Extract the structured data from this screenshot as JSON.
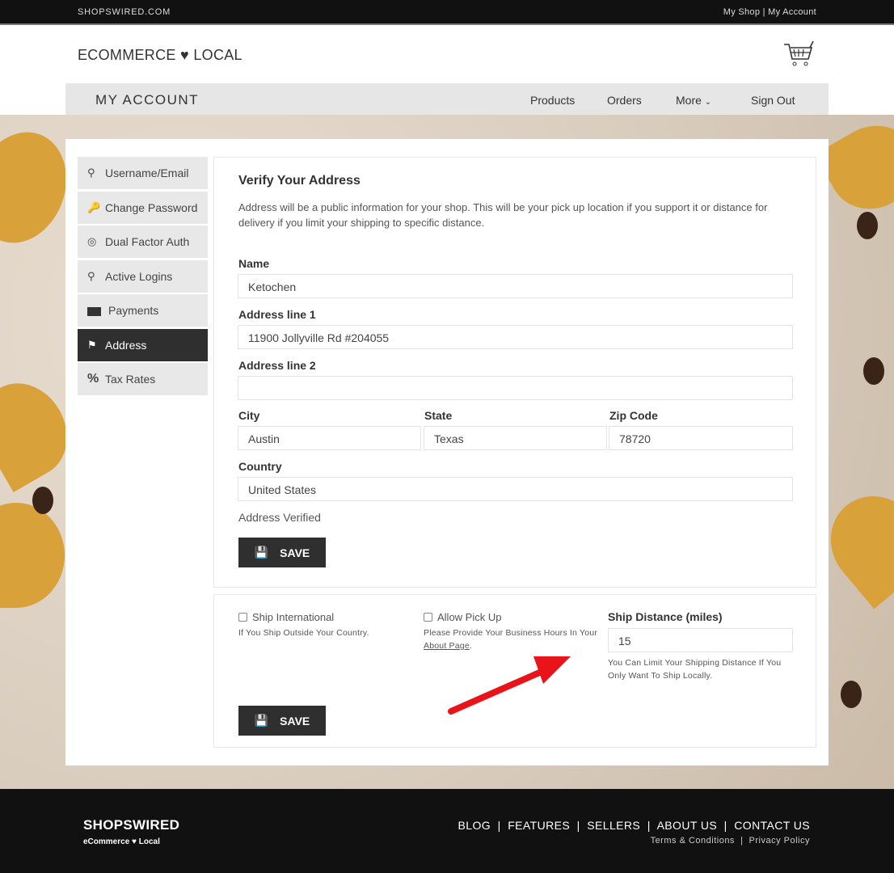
{
  "topbar": {
    "site": "SHOPSWIRED.COM",
    "my_shop": "My Shop",
    "sep": "|",
    "my_account": "My Account"
  },
  "header": {
    "logo_left": "ECOMMERCE",
    "logo_right": "LOCAL"
  },
  "nav": {
    "title": "MY ACCOUNT",
    "items": [
      "Products",
      "Orders",
      "More",
      "Sign Out"
    ]
  },
  "sidebar": {
    "items": [
      {
        "label": "Username/Email",
        "icon": "user-icon",
        "active": false
      },
      {
        "label": "Change Password",
        "icon": "key-icon",
        "active": false
      },
      {
        "label": "Dual Factor Auth",
        "icon": "fingerprint-icon",
        "active": false
      },
      {
        "label": "Active Logins",
        "icon": "user-icon",
        "active": false
      },
      {
        "label": "Payments",
        "icon": "money-bill-icon",
        "active": false
      },
      {
        "label": "Address",
        "icon": "map-marked-icon",
        "active": true
      },
      {
        "label": "Tax Rates",
        "icon": "percent-icon",
        "active": false
      }
    ]
  },
  "address": {
    "title": "Verify Your Address",
    "description": "Address will be a public information for your shop. This will be your pick up location if you support it or distance for delivery if you limit your shipping to specific distance.",
    "name_label": "Name",
    "name": "Ketochen",
    "line1_label": "Address line 1",
    "line1": "11900 Jollyville Rd #204055",
    "line2_label": "Address line 2",
    "line2": "",
    "city_label": "City",
    "city": "Austin",
    "state_label": "State",
    "state": "Texas",
    "zip_label": "Zip Code",
    "zip": "78720",
    "country_label": "Country",
    "country": "United States",
    "status": "Address Verified",
    "save": "SAVE"
  },
  "shipping": {
    "intl_label": "Ship International",
    "intl_checked": false,
    "intl_hint": "If You Ship Outside Your Country.",
    "pickup_label": "Allow Pick Up",
    "pickup_checked": false,
    "pickup_hint": "Please Provide Your Business Hours In Your",
    "pickup_link": "About Page",
    "distance_label": "Ship Distance (miles)",
    "distance": "15",
    "distance_hint": "You Can Limit Your Shipping Distance If You Only Want To Ship Locally.",
    "save": "SAVE"
  },
  "annotation_color": "#e8141a",
  "footer": {
    "brand": "SHOPSWIRED",
    "tagline_left": "eCommerce",
    "tagline_right": "Local",
    "links": [
      "BLOG",
      "FEATURES",
      "SELLERS",
      "ABOUT US",
      "CONTACT US"
    ],
    "terms": "Terms & Conditions",
    "privacy": "Privacy Policy"
  }
}
